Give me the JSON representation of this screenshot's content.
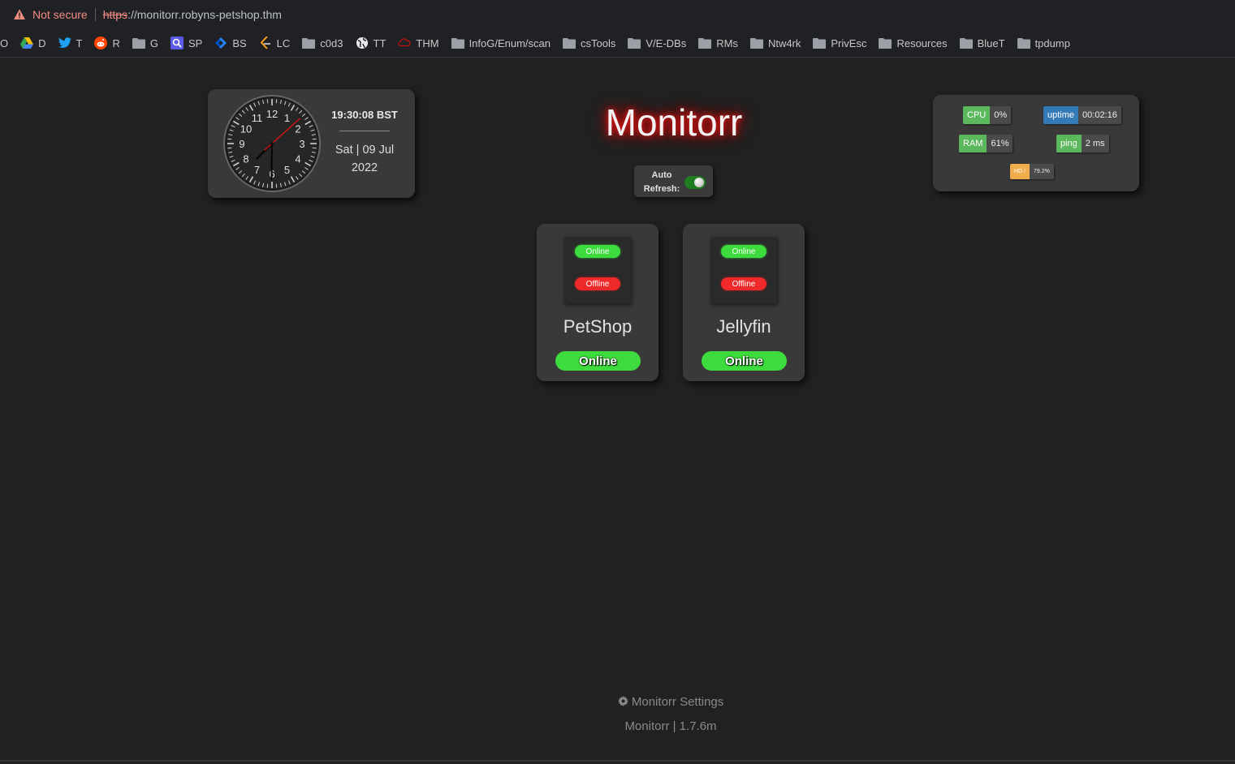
{
  "browser": {
    "security_label": "Not secure",
    "url_protocol": "https",
    "url_rest": "://monitorr.robyns-petshop.thm"
  },
  "bookmarks": [
    {
      "label": "O",
      "icon": "none"
    },
    {
      "label": "D",
      "icon": "google-drive-icon"
    },
    {
      "label": "T",
      "icon": "twitter-icon"
    },
    {
      "label": "R",
      "icon": "reddit-icon"
    },
    {
      "label": "G",
      "icon": "folder-icon"
    },
    {
      "label": "SP",
      "icon": "search-icon"
    },
    {
      "label": "BS",
      "icon": "jira-icon"
    },
    {
      "label": "LC",
      "icon": "leetcode-icon"
    },
    {
      "label": "c0d3",
      "icon": "folder-icon"
    },
    {
      "label": "TT",
      "icon": "globe-icon"
    },
    {
      "label": "THM",
      "icon": "tryhackme-icon"
    },
    {
      "label": "InfoG/Enum/scan",
      "icon": "folder-icon"
    },
    {
      "label": "csTools",
      "icon": "folder-icon"
    },
    {
      "label": "V/E-DBs",
      "icon": "folder-icon"
    },
    {
      "label": "RMs",
      "icon": "folder-icon"
    },
    {
      "label": "Ntw4rk",
      "icon": "folder-icon"
    },
    {
      "label": "PrivEsc",
      "icon": "folder-icon"
    },
    {
      "label": "Resources",
      "icon": "folder-icon"
    },
    {
      "label": "BlueT",
      "icon": "folder-icon"
    },
    {
      "label": "tpdump",
      "icon": "folder-icon"
    }
  ],
  "clock": {
    "time": "19:30:08 BST",
    "date_line1": "Sat | 09 Jul",
    "date_line2": "2022",
    "numerals": [
      "12",
      "1",
      "2",
      "3",
      "4",
      "5",
      "6",
      "7",
      "8",
      "9",
      "10",
      "11"
    ]
  },
  "title": "Monitorr",
  "auto_refresh": {
    "label_line1": "Auto",
    "label_line2": "Refresh:",
    "enabled": true
  },
  "stats": {
    "cpu": {
      "label": "CPU",
      "value": "0%"
    },
    "uptime": {
      "label": "uptime",
      "value": "00:02:16"
    },
    "ram": {
      "label": "RAM",
      "value": "61%"
    },
    "ping": {
      "label": "ping",
      "value": "2 ms"
    },
    "hd": {
      "label": "HD /",
      "value": "79.2%"
    }
  },
  "services": [
    {
      "name": "PetShop",
      "status": "Online",
      "online_badge": "Online",
      "offline_badge": "Offline"
    },
    {
      "name": "Jellyfin",
      "status": "Online",
      "online_badge": "Online",
      "offline_badge": "Offline"
    }
  ],
  "footer": {
    "settings_label": "Monitorr Settings",
    "version": "Monitorr | 1.7.6m"
  },
  "colors": {
    "background": "#212121",
    "panel": "#393939",
    "online": "#3ddb3d",
    "offline": "#ee2a2a",
    "title_glow": "#ff1a1a"
  }
}
